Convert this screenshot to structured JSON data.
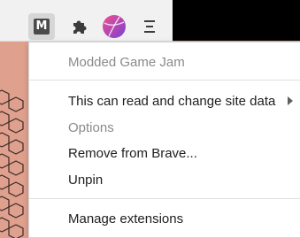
{
  "toolbar": {
    "extension_letter": "M"
  },
  "menu": {
    "title": "Modded Game Jam",
    "items": [
      {
        "label": "This can read and change site data",
        "has_submenu": true,
        "enabled": true
      },
      {
        "label": "Options",
        "enabled": false
      },
      {
        "label": "Remove from Brave...",
        "enabled": true
      },
      {
        "label": "Unpin",
        "enabled": true
      }
    ],
    "manage_label": "Manage extensions"
  },
  "colors": {
    "page_background": "#dfa08d",
    "toolbar_background": "#f1f1f1",
    "avatar_gradient_start": "#f0508f",
    "avatar_gradient_end": "#7b3fd6",
    "disabled_text": "#8a8a8a",
    "menu_text": "#202020"
  },
  "icons": {
    "extension": "letter-m-extension-icon",
    "extensions_menu": "puzzle-icon",
    "profile": "avatar-icon",
    "browser_menu": "hamburger-menu-icon"
  }
}
